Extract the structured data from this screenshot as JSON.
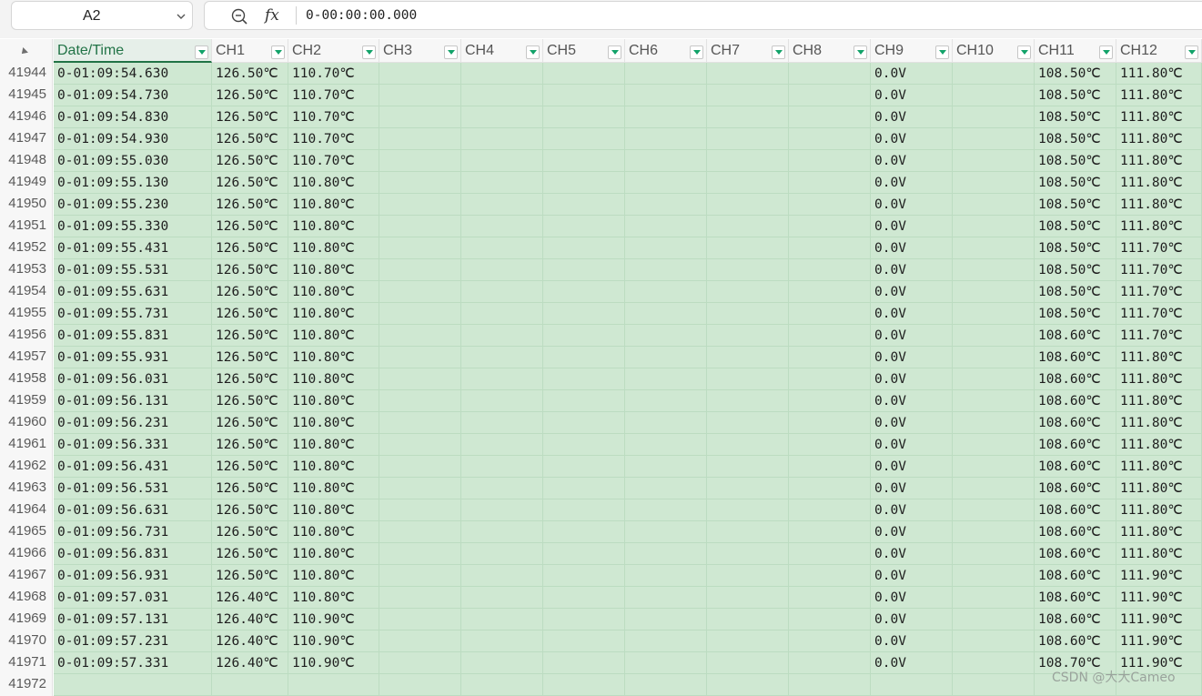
{
  "formula_bar": {
    "name_box": "A2",
    "fx_label": "fx",
    "formula": "0-00:00:00.000"
  },
  "columns": [
    "Date/Time",
    "CH1",
    "CH2",
    "CH3",
    "CH4",
    "CH5",
    "CH6",
    "CH7",
    "CH8",
    "CH9",
    "CH10",
    "CH11",
    "CH12"
  ],
  "rows": [
    {
      "n": "41944",
      "v": [
        "0-01:09:54.630",
        "126.50℃",
        "110.70℃",
        "",
        "",
        "",
        "",
        "",
        "",
        "0.0V",
        "",
        "108.50℃",
        "111.80℃"
      ]
    },
    {
      "n": "41945",
      "v": [
        "0-01:09:54.730",
        "126.50℃",
        "110.70℃",
        "",
        "",
        "",
        "",
        "",
        "",
        "0.0V",
        "",
        "108.50℃",
        "111.80℃"
      ]
    },
    {
      "n": "41946",
      "v": [
        "0-01:09:54.830",
        "126.50℃",
        "110.70℃",
        "",
        "",
        "",
        "",
        "",
        "",
        "0.0V",
        "",
        "108.50℃",
        "111.80℃"
      ]
    },
    {
      "n": "41947",
      "v": [
        "0-01:09:54.930",
        "126.50℃",
        "110.70℃",
        "",
        "",
        "",
        "",
        "",
        "",
        "0.0V",
        "",
        "108.50℃",
        "111.80℃"
      ]
    },
    {
      "n": "41948",
      "v": [
        "0-01:09:55.030",
        "126.50℃",
        "110.70℃",
        "",
        "",
        "",
        "",
        "",
        "",
        "0.0V",
        "",
        "108.50℃",
        "111.80℃"
      ]
    },
    {
      "n": "41949",
      "v": [
        "0-01:09:55.130",
        "126.50℃",
        "110.80℃",
        "",
        "",
        "",
        "",
        "",
        "",
        "0.0V",
        "",
        "108.50℃",
        "111.80℃"
      ]
    },
    {
      "n": "41950",
      "v": [
        "0-01:09:55.230",
        "126.50℃",
        "110.80℃",
        "",
        "",
        "",
        "",
        "",
        "",
        "0.0V",
        "",
        "108.50℃",
        "111.80℃"
      ]
    },
    {
      "n": "41951",
      "v": [
        "0-01:09:55.330",
        "126.50℃",
        "110.80℃",
        "",
        "",
        "",
        "",
        "",
        "",
        "0.0V",
        "",
        "108.50℃",
        "111.80℃"
      ]
    },
    {
      "n": "41952",
      "v": [
        "0-01:09:55.431",
        "126.50℃",
        "110.80℃",
        "",
        "",
        "",
        "",
        "",
        "",
        "0.0V",
        "",
        "108.50℃",
        "111.70℃"
      ]
    },
    {
      "n": "41953",
      "v": [
        "0-01:09:55.531",
        "126.50℃",
        "110.80℃",
        "",
        "",
        "",
        "",
        "",
        "",
        "0.0V",
        "",
        "108.50℃",
        "111.70℃"
      ]
    },
    {
      "n": "41954",
      "v": [
        "0-01:09:55.631",
        "126.50℃",
        "110.80℃",
        "",
        "",
        "",
        "",
        "",
        "",
        "0.0V",
        "",
        "108.50℃",
        "111.70℃"
      ]
    },
    {
      "n": "41955",
      "v": [
        "0-01:09:55.731",
        "126.50℃",
        "110.80℃",
        "",
        "",
        "",
        "",
        "",
        "",
        "0.0V",
        "",
        "108.50℃",
        "111.70℃"
      ]
    },
    {
      "n": "41956",
      "v": [
        "0-01:09:55.831",
        "126.50℃",
        "110.80℃",
        "",
        "",
        "",
        "",
        "",
        "",
        "0.0V",
        "",
        "108.60℃",
        "111.70℃"
      ]
    },
    {
      "n": "41957",
      "v": [
        "0-01:09:55.931",
        "126.50℃",
        "110.80℃",
        "",
        "",
        "",
        "",
        "",
        "",
        "0.0V",
        "",
        "108.60℃",
        "111.80℃"
      ]
    },
    {
      "n": "41958",
      "v": [
        "0-01:09:56.031",
        "126.50℃",
        "110.80℃",
        "",
        "",
        "",
        "",
        "",
        "",
        "0.0V",
        "",
        "108.60℃",
        "111.80℃"
      ]
    },
    {
      "n": "41959",
      "v": [
        "0-01:09:56.131",
        "126.50℃",
        "110.80℃",
        "",
        "",
        "",
        "",
        "",
        "",
        "0.0V",
        "",
        "108.60℃",
        "111.80℃"
      ]
    },
    {
      "n": "41960",
      "v": [
        "0-01:09:56.231",
        "126.50℃",
        "110.80℃",
        "",
        "",
        "",
        "",
        "",
        "",
        "0.0V",
        "",
        "108.60℃",
        "111.80℃"
      ]
    },
    {
      "n": "41961",
      "v": [
        "0-01:09:56.331",
        "126.50℃",
        "110.80℃",
        "",
        "",
        "",
        "",
        "",
        "",
        "0.0V",
        "",
        "108.60℃",
        "111.80℃"
      ]
    },
    {
      "n": "41962",
      "v": [
        "0-01:09:56.431",
        "126.50℃",
        "110.80℃",
        "",
        "",
        "",
        "",
        "",
        "",
        "0.0V",
        "",
        "108.60℃",
        "111.80℃"
      ]
    },
    {
      "n": "41963",
      "v": [
        "0-01:09:56.531",
        "126.50℃",
        "110.80℃",
        "",
        "",
        "",
        "",
        "",
        "",
        "0.0V",
        "",
        "108.60℃",
        "111.80℃"
      ]
    },
    {
      "n": "41964",
      "v": [
        "0-01:09:56.631",
        "126.50℃",
        "110.80℃",
        "",
        "",
        "",
        "",
        "",
        "",
        "0.0V",
        "",
        "108.60℃",
        "111.80℃"
      ]
    },
    {
      "n": "41965",
      "v": [
        "0-01:09:56.731",
        "126.50℃",
        "110.80℃",
        "",
        "",
        "",
        "",
        "",
        "",
        "0.0V",
        "",
        "108.60℃",
        "111.80℃"
      ]
    },
    {
      "n": "41966",
      "v": [
        "0-01:09:56.831",
        "126.50℃",
        "110.80℃",
        "",
        "",
        "",
        "",
        "",
        "",
        "0.0V",
        "",
        "108.60℃",
        "111.80℃"
      ]
    },
    {
      "n": "41967",
      "v": [
        "0-01:09:56.931",
        "126.50℃",
        "110.80℃",
        "",
        "",
        "",
        "",
        "",
        "",
        "0.0V",
        "",
        "108.60℃",
        "111.90℃"
      ]
    },
    {
      "n": "41968",
      "v": [
        "0-01:09:57.031",
        "126.40℃",
        "110.80℃",
        "",
        "",
        "",
        "",
        "",
        "",
        "0.0V",
        "",
        "108.60℃",
        "111.90℃"
      ]
    },
    {
      "n": "41969",
      "v": [
        "0-01:09:57.131",
        "126.40℃",
        "110.90℃",
        "",
        "",
        "",
        "",
        "",
        "",
        "0.0V",
        "",
        "108.60℃",
        "111.90℃"
      ]
    },
    {
      "n": "41970",
      "v": [
        "0-01:09:57.231",
        "126.40℃",
        "110.90℃",
        "",
        "",
        "",
        "",
        "",
        "",
        "0.0V",
        "",
        "108.60℃",
        "111.90℃"
      ]
    },
    {
      "n": "41971",
      "v": [
        "0-01:09:57.331",
        "126.40℃",
        "110.90℃",
        "",
        "",
        "",
        "",
        "",
        "",
        "0.0V",
        "",
        "108.70℃",
        "111.90℃"
      ]
    },
    {
      "n": "41972",
      "v": [
        "",
        "",
        "",
        "",
        "",
        "",
        "",
        "",
        "",
        "",
        "",
        "",
        ""
      ]
    }
  ],
  "watermark": "CSDN @大大Cameo",
  "colors": {
    "cell_fill": "#cfe8d2",
    "accent": "#217346",
    "filter_arrow": "#13a36a"
  }
}
